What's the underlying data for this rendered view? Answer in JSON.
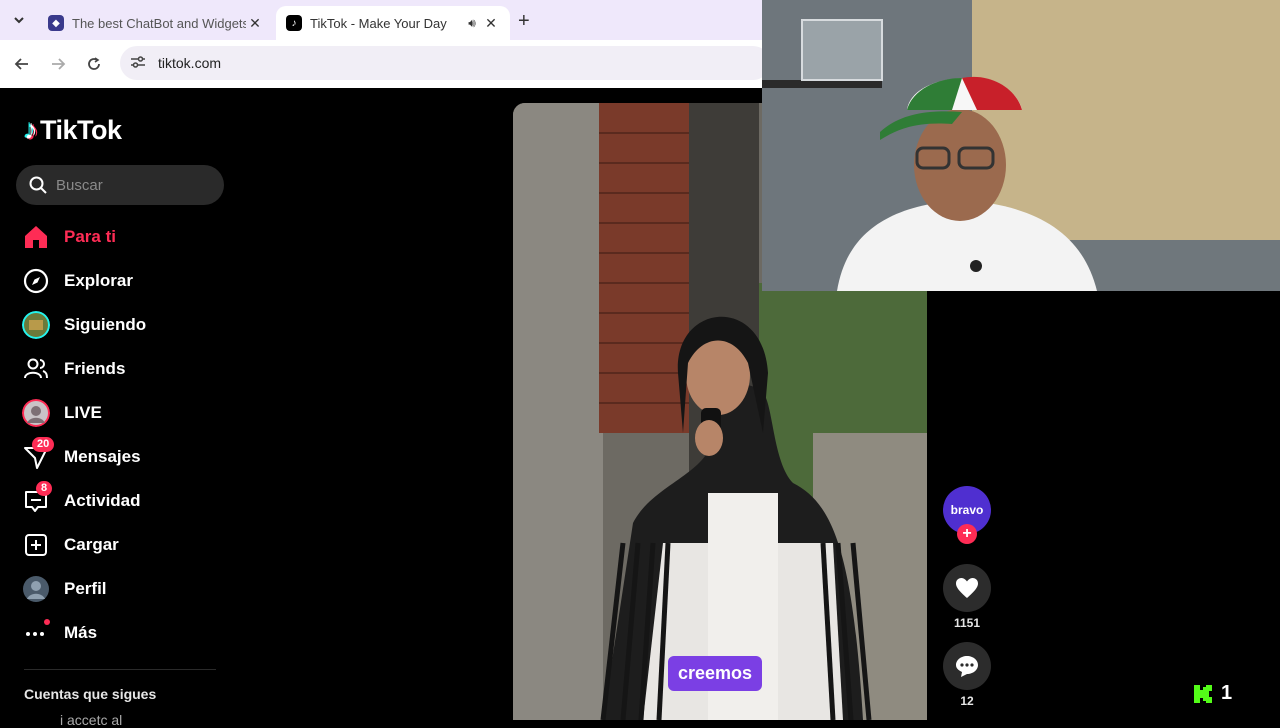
{
  "browser": {
    "tabs": [
      {
        "title": "The best ChatBot and Widgets",
        "icon": "chatbot-favicon-icon",
        "active": false
      },
      {
        "title": "TikTok - Make Your Day",
        "icon": "tiktok-favicon-icon",
        "active": true
      }
    ],
    "url": "tiktok.com"
  },
  "sidebar": {
    "logo_text": "TikTok",
    "search_placeholder": "Buscar",
    "items": [
      {
        "label": "Para ti",
        "icon": "home-icon",
        "active": true
      },
      {
        "label": "Explorar",
        "icon": "compass-icon"
      },
      {
        "label": "Siguiendo",
        "icon": "following-avatar"
      },
      {
        "label": "Friends",
        "icon": "friends-icon"
      },
      {
        "label": "LIVE",
        "icon": "live-avatar"
      },
      {
        "label": "Mensajes",
        "icon": "messages-icon",
        "badge": "20"
      },
      {
        "label": "Actividad",
        "icon": "activity-icon",
        "badge": "8"
      },
      {
        "label": "Cargar",
        "icon": "upload-icon"
      },
      {
        "label": "Perfil",
        "icon": "profile-avatar"
      },
      {
        "label": "Más",
        "icon": "more-icon"
      }
    ],
    "following_title": "Cuentas que sigues",
    "following_partial": "i accetc al"
  },
  "video": {
    "caption": "creemos"
  },
  "actions": {
    "creator_name": "bravo",
    "likes": "1151",
    "comments": "12"
  },
  "overlay": {
    "kick_count": "1"
  },
  "colors": {
    "accent": "#fe2c55",
    "caption_bg": "#7b3fe4",
    "kick_green": "#53fc18"
  }
}
